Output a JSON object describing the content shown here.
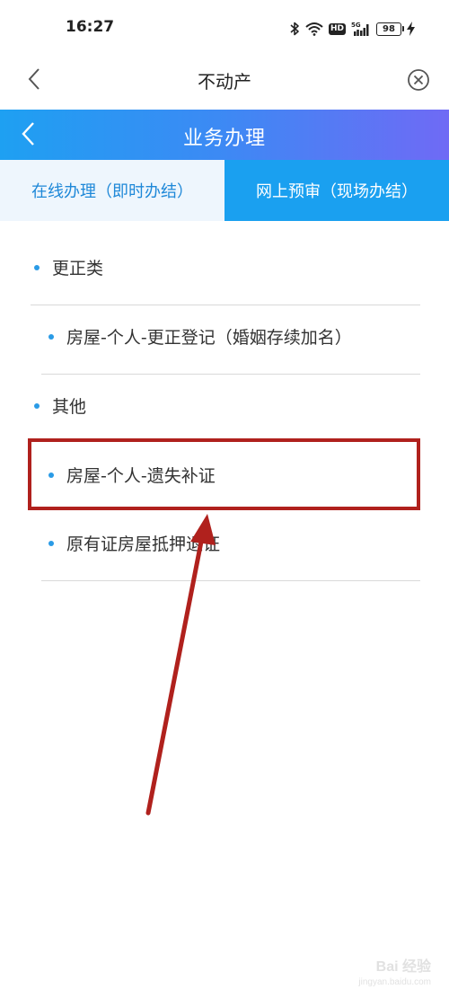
{
  "status_bar": {
    "time": "16:27",
    "network": "5G",
    "hd_label": "HD",
    "battery": "98"
  },
  "nav": {
    "title": "不动产",
    "back_icon": "chevron-left-icon",
    "close_icon": "close-circle-icon"
  },
  "banner": {
    "title": "业务办理",
    "back_icon": "chevron-left-icon"
  },
  "tabs": [
    {
      "label": "在线办理（即时办结）",
      "active": true
    },
    {
      "label": "网上预审（现场办结）",
      "active": false
    }
  ],
  "list": {
    "categories": [
      {
        "label": "更正类",
        "items": [
          {
            "label": "房屋-个人-更正登记（婚姻存续加名）"
          }
        ]
      },
      {
        "label": "其他",
        "items": [
          {
            "label": "房屋-个人-遗失补证"
          },
          {
            "label": "原有证房屋抵押退证"
          }
        ]
      }
    ]
  },
  "watermark": {
    "logo": "Bai 经验",
    "url": "jingyan.baidu.com"
  },
  "colors": {
    "accent": "#1e88d8",
    "tab_inactive_bg": "#1aa0f0",
    "tab_active_bg": "#eef6fd",
    "dot": "#2a9be6",
    "annotation": "#b0211d",
    "banner_gradient_start": "#1ea0f2",
    "banner_gradient_end": "#6f6af5"
  }
}
